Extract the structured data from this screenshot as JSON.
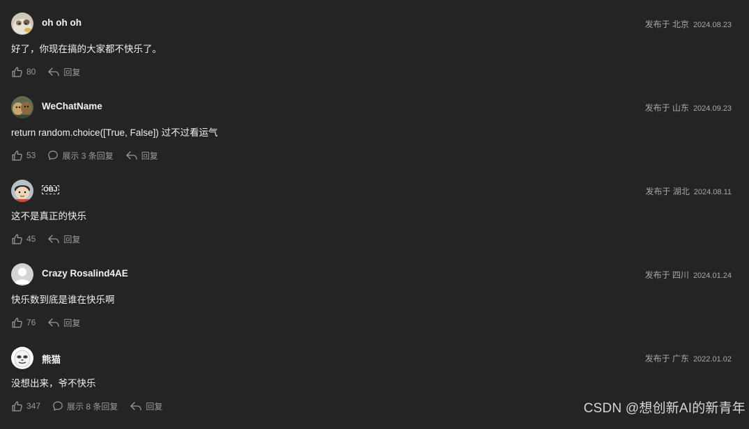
{
  "comments": [
    {
      "username": "oh oh oh",
      "location": "发布于 北京",
      "date": "2024.08.23",
      "text": "好了，你现在搞的大家都不快乐了。",
      "likes": "80",
      "reply_label": "回复",
      "avatar": "cat-photo-avatar"
    },
    {
      "username": "WeChatName",
      "location": "发布于 山东",
      "date": "2024.09.23",
      "text": "return random.choice([True, False]) 过不过看运气",
      "likes": "53",
      "show_replies": "展示 3 条回复",
      "reply_label": "回复",
      "avatar": "dogs-photo-avatar"
    },
    {
      "username": "OBJ",
      "location": "发布于 湖北",
      "date": "2024.08.11",
      "text": "这不是真正的快乐",
      "likes": "45",
      "reply_label": "回复",
      "avatar": "cartoon-avatar"
    },
    {
      "username": "Crazy Rosalind4AE",
      "location": "发布于 四川",
      "date": "2024.01.24",
      "text": "快乐数到底是谁在快乐啊",
      "likes": "76",
      "reply_label": "回复",
      "avatar": "default-user-avatar"
    },
    {
      "username": "熊猫",
      "location": "发布于 广东",
      "date": "2022.01.02",
      "text": "没想出来，爷不快乐",
      "likes": "347",
      "show_replies": "展示 8 条回复",
      "reply_label": "回复",
      "avatar": "panda-meme-avatar"
    }
  ],
  "watermark": "CSDN @想创新AI的新青年",
  "colors": {
    "background": "#242424",
    "text": "#f0f0f0",
    "muted": "#9a9a9a"
  }
}
